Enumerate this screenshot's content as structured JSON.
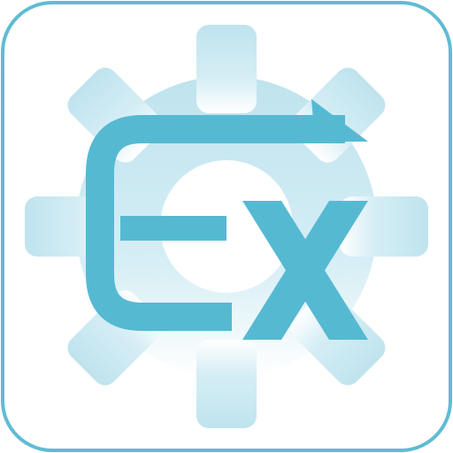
{
  "icon": {
    "name": "expression-gear-app-icon",
    "symbol_text": "Ex",
    "colors": {
      "frame_border": "#5fbcd3",
      "frame_fill": "#ffffff",
      "gear_top": "#bfe3ee",
      "gear_bottom": "#ffffff",
      "glyph": "#56b9d2"
    },
    "elements": [
      "gear-icon",
      "arrow-icon",
      "letter-e-glyph",
      "letter-x-glyph"
    ]
  }
}
